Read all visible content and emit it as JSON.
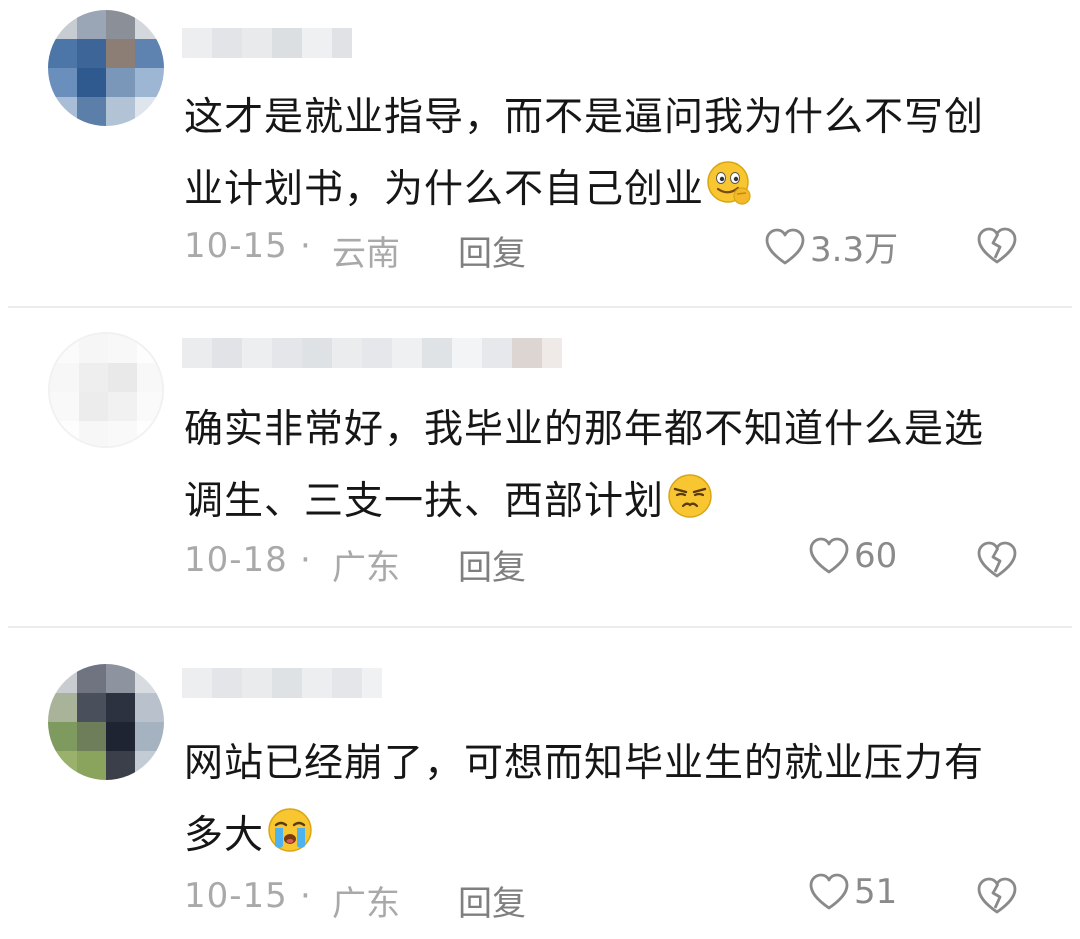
{
  "comments": [
    {
      "text": "这才是就业指导，而不是逼问我为什么不写创业计划书，为什么不自己创业",
      "emoji": "smirk-emoji",
      "date": "10-15",
      "location": "云南",
      "reply_label": "回复",
      "likes": "3.3万"
    },
    {
      "text": "确实非常好，我毕业的那年都不知道什么是选调生、三支一扶、西部计划",
      "emoji": "unamused-emoji",
      "date": "10-18",
      "location": "广东",
      "reply_label": "回复",
      "likes": "60"
    },
    {
      "text": "网站已经崩了，可想而知毕业生的就业压力有多大",
      "emoji": "crying-emoji",
      "date": "10-15",
      "location": "广东",
      "reply_label": "回复",
      "likes": "51"
    }
  ],
  "separator": "·",
  "colors": {
    "text": "#161616",
    "meta": "#a9a9a9",
    "divider": "#ececec",
    "emoji_yellow": "#f7c631"
  }
}
